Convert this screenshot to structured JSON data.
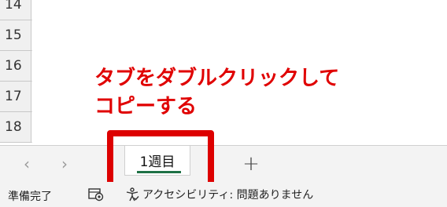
{
  "grid": {
    "rows": [
      {
        "number": "14"
      },
      {
        "number": "15"
      },
      {
        "number": "16"
      },
      {
        "number": "17"
      },
      {
        "number": "18"
      }
    ]
  },
  "annotation": {
    "line1": "タブをダブルクリックして",
    "line2": "コピーする",
    "color": "#e00000"
  },
  "tabbar": {
    "prev_icon": "chevron-left-icon",
    "next_icon": "chevron-right-icon",
    "prev_glyph": "‹",
    "next_glyph": "›",
    "sheet_tab_label": "1週目",
    "add_glyph": "+",
    "accent_color": "#1e7145"
  },
  "statusbar": {
    "ready_text": "準備完了",
    "accessibility_text": "アクセシビリティ: 問題ありません"
  }
}
